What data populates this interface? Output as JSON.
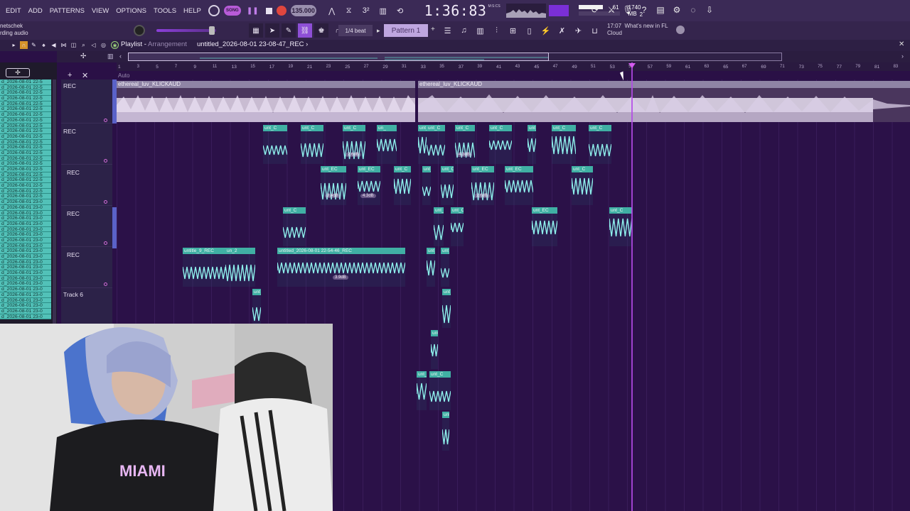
{
  "menu": [
    "EDIT",
    "ADD",
    "PATTERNS",
    "VIEW",
    "OPTIONS",
    "TOOLS",
    "HELP"
  ],
  "transport": {
    "mode_label": "SONG",
    "tempo": "135.000",
    "time": "1:36:83",
    "time_unit": "M:S:CS"
  },
  "cpu": {
    "value1": "61",
    "memory": "1740 MB",
    "value3": "2"
  },
  "hint_panel": {
    "line1": "netschek",
    "line2": "rding audio"
  },
  "snap": "1/4 beat",
  "pattern": "Pattern 1",
  "news": {
    "time": "17:07",
    "text": "What's new in FL",
    "sub": "Cloud"
  },
  "playlist": {
    "title": "Playlist",
    "subtitle": "Arrangement",
    "file": "untitled_2026-08-01 23-08-47_REC"
  },
  "auto_label": "Auto",
  "ruler_marks": [
    "1",
    "3",
    "5",
    "7",
    "9",
    "11",
    "13",
    "15",
    "17",
    "19",
    "21",
    "23",
    "25",
    "27",
    "29",
    "31",
    "33",
    "35",
    "37",
    "39",
    "41",
    "43",
    "45",
    "47",
    "49",
    "51",
    "53",
    "55",
    "57",
    "59",
    "61",
    "63",
    "65",
    "67",
    "69",
    "71",
    "73",
    "75",
    "77",
    "79",
    "81",
    "83"
  ],
  "picker_items": [
    "d_2026-08-01 22-5",
    "d_2026-08-01 22-5",
    "d_2026-08-01 22-5",
    "d_2026-08-01 22-5",
    "d_2026-08-01 22-5",
    "d_2026-08-01 22-5",
    "d_2026-08-01 22-5",
    "d_2026-08-01 22-5",
    "d_2026-08-01 22-5",
    "d_2026-08-01 22-5",
    "d_2026-08-01 22-5",
    "d_2026-08-01 22-5",
    "d_2026-08-01 22-5",
    "d_2026-08-01 22-5",
    "d_2026-08-01 22-5",
    "d_2026-08-01 22-5",
    "d_2026-08-01 22-5",
    "d_2026-08-01 22-5",
    "d_2026-08-01 22-5",
    "d_2026-08-01 22-5",
    "d_2026-08-01 22-5",
    "d_2026-08-01 22-5",
    "d_2026-08-01 23-0",
    "d_2026-08-01 23-0",
    "d_2026-08-01 23-0",
    "d_2026-08-01 23-0",
    "d_2026-08-01 23-0",
    "d_2026-08-01 23-0",
    "d_2026-08-01 23-0",
    "d_2026-08-01 23-0",
    "d_2026-08-01 23-0",
    "d_2026-08-01 23-0",
    "d_2026-08-01 23-0",
    "d_2026-08-01 23-0",
    "d_2026-08-01 23-0",
    "d_2026-08-01 23-0",
    "d_2026-08-01 23-0",
    "d_2026-08-01 23-0",
    "d_2026-08-01 23-0",
    "d_2026-08-01 23-0",
    "d_2026-08-01 23-0",
    "d_2026-08-01 23-0",
    "d_2026-08-01 23-0",
    "d_2026-08-01 23-0"
  ],
  "tracks": [
    "REC",
    "REC",
    "REC",
    "REC",
    "REC",
    "Track 6"
  ],
  "clips": {
    "main1": "ethereal_luv_KLICKAUD",
    "main2": "ethereal_luv_KLICKAUD",
    "short": "unt_C",
    "short2": "unt_EC",
    "short3": "un_",
    "untitle9": "untitle_9_REC",
    "un2": "un_2",
    "long": "untitled_2026-08-01 22-54-46_REC",
    "gain_a": "2.6dB",
    "gain_b": "4.3dB",
    "gain_c": "3.4dB",
    "gain_d": "4.3dB",
    "gain_e": "2.6dB",
    "gain_f": "3.9dB"
  },
  "colors": {
    "accent": "#b44ae8",
    "clip": "#40b0a4",
    "background": "#2b1148"
  }
}
